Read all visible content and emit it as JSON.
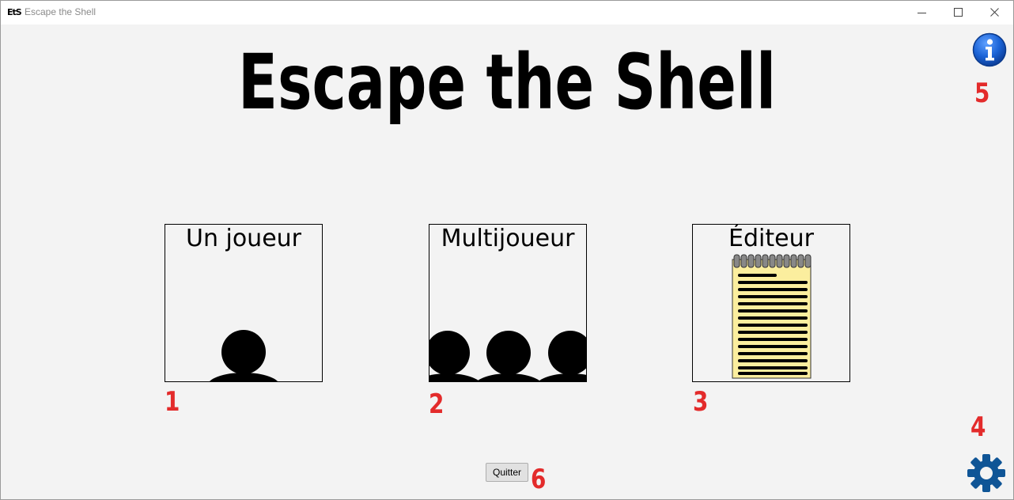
{
  "window": {
    "app_icon_text": "EtS",
    "title": "Escape the Shell"
  },
  "header": {
    "title": "Escape the Shell"
  },
  "modes": [
    {
      "label": "Un joueur",
      "number": "1"
    },
    {
      "label": "Multijoueur",
      "number": "2"
    },
    {
      "label": "Éditeur",
      "number": "3"
    }
  ],
  "annotations": {
    "settings_number": "4",
    "info_number": "5",
    "quit_number": "6"
  },
  "quit_button": {
    "label": "Quitter"
  },
  "icons": {
    "info": "info-icon",
    "settings": "gear-icon",
    "solo": "single-person-icon",
    "multi": "group-people-icon",
    "editor": "notepad-icon"
  },
  "colors": {
    "background": "#f3f3f3",
    "annotation_red": "#e32b2b",
    "info_blue": "#1b63d6",
    "gear_blue": "#0f5596",
    "notepad_yellow": "#fbee9e"
  }
}
